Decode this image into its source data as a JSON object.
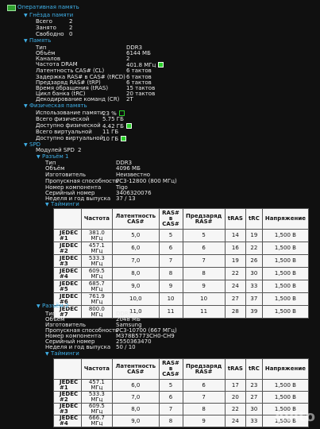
{
  "root": {
    "label": "Оперативная память"
  },
  "slots_group": {
    "label": "Гнёзда памяти",
    "rows": [
      {
        "label": "Всего",
        "value": "2"
      },
      {
        "label": "Занято",
        "value": "2"
      },
      {
        "label": "Свободно",
        "value": "0"
      }
    ]
  },
  "memory": {
    "label": "Память",
    "rows": [
      {
        "label": "Тип",
        "value": "DDR3"
      },
      {
        "label": "Объём",
        "value": "6144 МБ"
      },
      {
        "label": "Каналов",
        "value": "2"
      },
      {
        "label": "Частота DRAM",
        "value": "401.8 МГц"
      },
      {
        "label": "Латентность CAS# (CL)",
        "value": "6 тактов"
      },
      {
        "label": "Задержка RAS# в CAS# (tRCD)",
        "value": "6 тактов"
      },
      {
        "label": "Предзаряд RAS# (tRP)",
        "value": "6 тактов"
      },
      {
        "label": "Время обращения (tRAS)",
        "value": "15 тактов"
      },
      {
        "label": "Цикл банка (tRC)",
        "value": "20 тактов"
      },
      {
        "label": "Декодирование команд (CR)",
        "value": "2T"
      }
    ]
  },
  "physical": {
    "label": "Физическая память",
    "rows": [
      {
        "label": "Использование памяти",
        "value": "23 %"
      },
      {
        "label": "Всего физической",
        "value": "5.75 ГБ"
      },
      {
        "label": "Доступно физической",
        "value": "4.42 ГБ"
      },
      {
        "label": "Всего виртуальной",
        "value": "11 ГБ"
      },
      {
        "label": "Доступно виртуальной",
        "value": "10 ГБ"
      }
    ]
  },
  "spd": {
    "label": "SPD",
    "modules_label": "Модулей SPD",
    "modules_value": "2",
    "timings_label": "Тайминги",
    "table_headers": [
      "Частота",
      "Латентность CAS#",
      "RAS# в CAS#",
      "Предзаряд RAS#",
      "tRAS",
      "tRC",
      "Напряжение"
    ],
    "slot1": {
      "label": "Разъём 1",
      "rows": [
        {
          "label": "Тип",
          "value": "DDR3"
        },
        {
          "label": "Объём",
          "value": "4096 МБ"
        },
        {
          "label": "Изготовитель",
          "value": "Неизвестно"
        },
        {
          "label": "Пропускная способность",
          "value": "PC3-12800 (800 МГц)"
        },
        {
          "label": "Номер компонента",
          "value": "Tigo"
        },
        {
          "label": "Серийный номер",
          "value": "3406320076"
        },
        {
          "label": "Неделя и год выпуска",
          "value": "37 / 13"
        }
      ],
      "timings": [
        [
          "JEDEC #1",
          "381.0 МГц",
          "5,0",
          "5",
          "5",
          "14",
          "19",
          "1,500 В"
        ],
        [
          "JEDEC #2",
          "457.1 МГц",
          "6,0",
          "6",
          "6",
          "16",
          "22",
          "1,500 В"
        ],
        [
          "JEDEC #3",
          "533.3 МГц",
          "7,0",
          "7",
          "7",
          "19",
          "26",
          "1,500 В"
        ],
        [
          "JEDEC #4",
          "609.5 МГц",
          "8,0",
          "8",
          "8",
          "22",
          "30",
          "1,500 В"
        ],
        [
          "JEDEC #5",
          "685.7 МГц",
          "9,0",
          "9",
          "9",
          "24",
          "33",
          "1,500 В"
        ],
        [
          "JEDEC #6",
          "761.9 МГц",
          "10,0",
          "10",
          "10",
          "27",
          "37",
          "1,500 В"
        ],
        [
          "JEDEC #7",
          "800.0 МГц",
          "11,0",
          "11",
          "11",
          "28",
          "39",
          "1,500 В"
        ]
      ]
    },
    "slot2": {
      "label": "Разъём 2",
      "rows": [
        {
          "label": "Тип",
          "value": "DDR3"
        },
        {
          "label": "Объём",
          "value": "2048 МБ"
        },
        {
          "label": "Изготовитель",
          "value": "Samsung"
        },
        {
          "label": "Пропускная способность",
          "value": "PC3-10700 (667 МГц)"
        },
        {
          "label": "Номер компонента",
          "value": "M378B5773CH0-CH9"
        },
        {
          "label": "Серийный номер",
          "value": "2550363470"
        },
        {
          "label": "Неделя и год выпуска",
          "value": "50 / 10"
        }
      ],
      "timings": [
        [
          "JEDEC #1",
          "457.1 МГц",
          "6,0",
          "5",
          "6",
          "17",
          "23",
          "1,500 В"
        ],
        [
          "JEDEC #2",
          "533.3 МГц",
          "7,0",
          "6",
          "7",
          "20",
          "27",
          "1,500 В"
        ],
        [
          "JEDEC #3",
          "609.5 МГц",
          "8,0",
          "7",
          "8",
          "22",
          "30",
          "1,500 В"
        ],
        [
          "JEDEC #4",
          "666.7 МГц",
          "9,0",
          "8",
          "9",
          "24",
          "33",
          "1,500 В"
        ]
      ]
    }
  },
  "watermark": "Avito",
  "colors": {
    "background": "#101010",
    "tree_node": "#3fb0e8",
    "indicator": "#2bd12b"
  }
}
